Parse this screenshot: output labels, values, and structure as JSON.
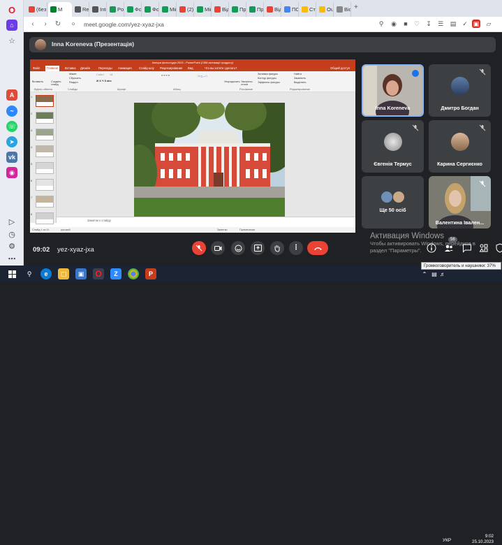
{
  "browser": {
    "tabs": [
      {
        "label": "(6eз",
        "icon": "gmail-icon",
        "color": "#ea4335",
        "x": 0
      },
      {
        "label": "M",
        "icon": "meet-icon",
        "color": "#00832d",
        "active": true
      },
      {
        "label": "Rest",
        "icon": "reshish-icon",
        "color": "#555555"
      },
      {
        "label": "Inte",
        "icon": "reshish-icon",
        "color": "#555555"
      },
      {
        "label": "Poбі",
        "icon": "classroom-icon",
        "color": "#0f9d58"
      },
      {
        "label": "Фор",
        "icon": "forms-icon",
        "color": "#0f9d58"
      },
      {
        "label": "Фор",
        "icon": "forms-icon",
        "color": "#0f9d58"
      },
      {
        "label": "Miй",
        "icon": "classroom-icon",
        "color": "#0f9d58"
      },
      {
        "label": "(2) (",
        "icon": "gmail-icon",
        "color": "#ea4335"
      },
      {
        "label": "Miй",
        "icon": "classroom-icon",
        "color": "#0f9d58"
      },
      {
        "label": "Від",
        "icon": "gmail-icon",
        "color": "#ea4335"
      },
      {
        "label": "Пре",
        "icon": "classroom-icon",
        "color": "#0f9d58"
      },
      {
        "label": "Про",
        "icon": "classroom-icon",
        "color": "#0f9d58"
      },
      {
        "label": "Від",
        "icon": "gmail-icon",
        "color": "#ea4335"
      },
      {
        "label": "ПС-",
        "icon": "doc-icon",
        "color": "#4285f4"
      },
      {
        "label": "Ста",
        "icon": "chrome-icon",
        "color": "#fbbc05"
      },
      {
        "label": "Our",
        "icon": "chrome-icon",
        "color": "#fbbc05"
      },
      {
        "label": "Biol",
        "icon": "tab-icon",
        "color": "#888888"
      }
    ],
    "url": "meet.google.com/yez-xyaz-jxa"
  },
  "meet": {
    "presenter_label": "Inna Koreneva (Презентація)",
    "time": "09:02",
    "meeting_code": "yez-xyaz-jxa",
    "participant_count": "56",
    "tiles": [
      {
        "name": "Inna Koreneva",
        "kind": "video-speaking"
      },
      {
        "name": "Дмитро Богдан",
        "kind": "avatar-muted"
      },
      {
        "name": "Євгенія Термус",
        "kind": "avatar-muted"
      },
      {
        "name": "Карина Сергиєнко",
        "kind": "avatar-muted"
      },
      {
        "name": "Ще 50 осіб",
        "kind": "others"
      },
      {
        "name": "Валентина Івален...",
        "kind": "video"
      }
    ]
  },
  "ppt": {
    "title": "Автора фотостудія 2023 - PowerPoint (Сбій активації продукту)",
    "menu": [
      "Файл",
      "Главная",
      "Вставка",
      "Дизайн",
      "Переходы",
      "Анимация",
      "Слайд-шоу",
      "Рецензирование",
      "Вид",
      "Что вы хотите сделать?",
      "Общий доступ"
    ],
    "ribbon_groups": [
      "Буфер обмена",
      "Слайды",
      "Шрифт",
      "Абзац",
      "Рисование",
      "Редактирование"
    ],
    "ribbon_buttons": {
      "paste": "Вставить",
      "new": "Макет",
      "create": "Создать слайд",
      "reset": "Сбросить",
      "section": "Раздел",
      "arrange": "Упорядочить",
      "styles": "Экспресс-стили",
      "fill": "Заливка фигуры",
      "outline": "Контур фигуры",
      "effects": "Эффекты фигуры",
      "find": "Найти",
      "replace": "Заменить",
      "select": "Выделить"
    },
    "thumb_numbers": [
      "1",
      "2",
      "3",
      "4",
      "5",
      "6",
      "7",
      "8"
    ],
    "notes_placeholder": "Заметки к слайду",
    "status": {
      "slide": "Слайд 1 из 11",
      "lang": "русский",
      "notes": "Заметки",
      "comments": "Примечания"
    }
  },
  "windows": {
    "activate_title": "Активация Windows",
    "activate_line1": "Чтобы активировать Windows, перейдите в",
    "activate_line2": "раздел \"Параметры\".",
    "tooltip": "Громкоговоритель и наушники: 37%",
    "lang": "УКР",
    "clock_time": "9:02",
    "clock_date": "25.10.2023"
  }
}
